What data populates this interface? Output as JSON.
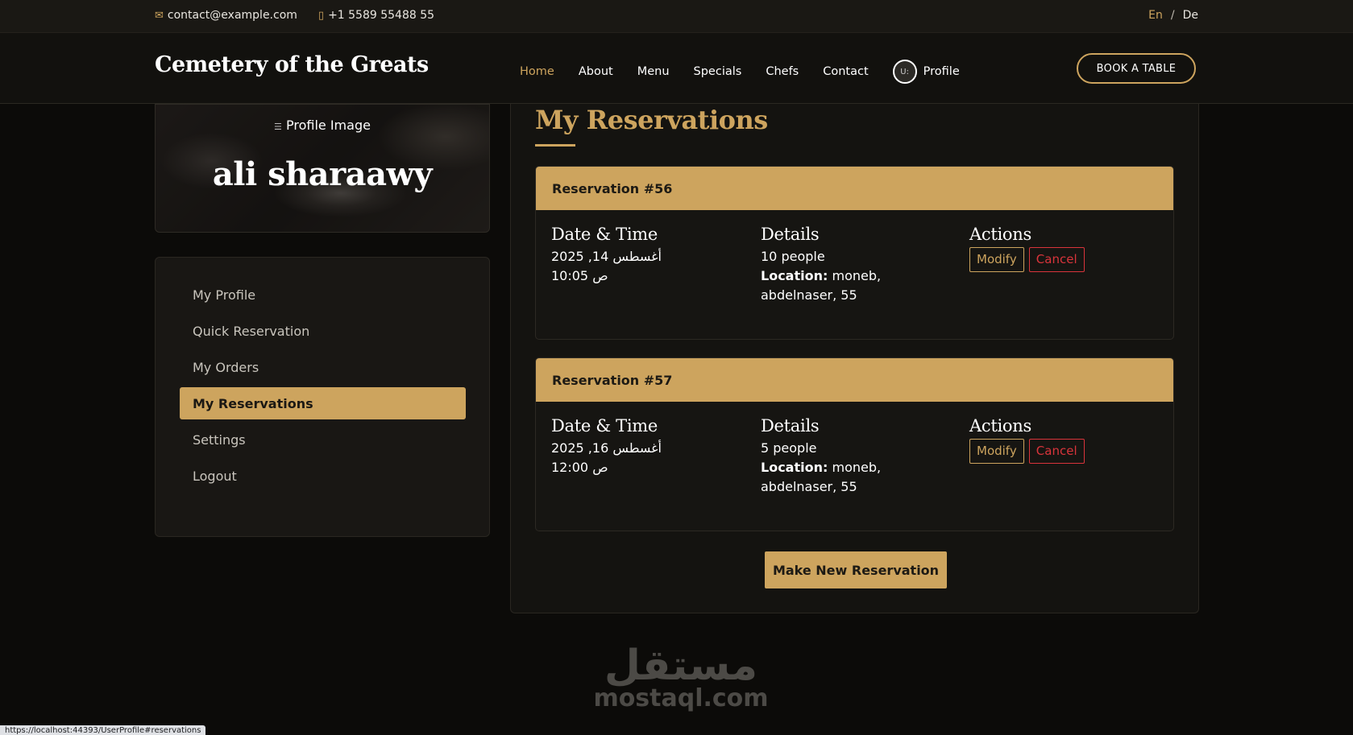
{
  "topbar": {
    "email": "contact@example.com",
    "phone": "+1 5589 55488 55",
    "lang_en": "En",
    "lang_sep": "/",
    "lang_de": "De"
  },
  "header": {
    "brand": "Cemetery of the Greats",
    "nav": [
      "Home",
      "About",
      "Menu",
      "Specials",
      "Chefs",
      "Contact"
    ],
    "avatar_alt": "U:",
    "profile": "Profile",
    "book_button": "BOOK A TABLE"
  },
  "profile": {
    "image_alt": "Profile Image",
    "name": "ali sharaawy"
  },
  "sidebar": {
    "items": [
      "My Profile",
      "Quick Reservation",
      "My Orders",
      "My Reservations",
      "Settings",
      "Logout"
    ],
    "active_index": 3
  },
  "main": {
    "title": "My Reservations",
    "col_date": "Date & Time",
    "col_details": "Details",
    "col_actions": "Actions",
    "location_label": "Location:",
    "modify": "Modify",
    "cancel": "Cancel",
    "reservations": [
      {
        "title": "Reservation #56",
        "date": "2025 ,14 أغسطس",
        "time": "10:05 ص",
        "people": "10 people",
        "location_1": "moneb,",
        "location_2": "abdelnaser, 55"
      },
      {
        "title": "Reservation #57",
        "date": "2025 ,16 أغسطس",
        "time": "12:00 ص",
        "people": "5 people",
        "location_1": "moneb,",
        "location_2": "abdelnaser, 55"
      }
    ],
    "new_button": "Make New Reservation"
  },
  "watermark": {
    "arabic": "مستقل",
    "latin": "mostaql.com"
  },
  "status_url": "https://localhost:44393/UserProfile#reservations",
  "colors": {
    "accent": "#cda45e",
    "danger": "#d9343b",
    "background": "#0c0b09"
  }
}
